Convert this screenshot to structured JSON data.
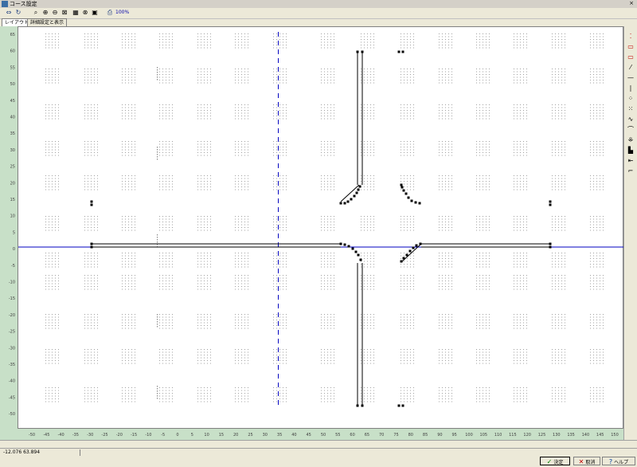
{
  "window": {
    "title": "コース設定",
    "close_glyph": "×"
  },
  "toolbar": {
    "zoom_label": "100%",
    "tools": [
      {
        "name": "open-icon",
        "glyph": "⇔"
      },
      {
        "name": "redo-icon",
        "glyph": "↻"
      },
      {
        "name": "zoom-icon",
        "glyph": "⌕"
      },
      {
        "name": "zoom-in-icon",
        "glyph": "⊕"
      },
      {
        "name": "zoom-out-icon",
        "glyph": "⊖"
      },
      {
        "name": "fit-icon",
        "glyph": "⊠"
      },
      {
        "name": "grid-icon",
        "glyph": "▦"
      },
      {
        "name": "link-icon",
        "glyph": "⊗"
      },
      {
        "name": "frame-icon",
        "glyph": "▣"
      },
      {
        "name": "print-icon",
        "glyph": "⎙"
      }
    ]
  },
  "tabs": [
    {
      "label": "レイアウト変更",
      "active": true
    },
    {
      "label": "詳細設定と表示",
      "active": false
    }
  ],
  "right_tools": [
    {
      "name": "select-point-icon",
      "glyph": "⁚",
      "red": true
    },
    {
      "name": "select-rect-icon",
      "glyph": "▭",
      "red": true
    },
    {
      "name": "select-line-icon",
      "glyph": "▭",
      "red": true
    },
    {
      "name": "line-diag-icon",
      "glyph": "⁄",
      "red": false
    },
    {
      "name": "line-horizontal-icon",
      "glyph": "—",
      "red": false
    },
    {
      "name": "line-vertical-icon",
      "glyph": "|",
      "red": false
    },
    {
      "name": "dots-diag-icon",
      "glyph": "⁘",
      "red": false
    },
    {
      "name": "dots-icon",
      "glyph": "⁙",
      "red": false
    },
    {
      "name": "curve-icon",
      "glyph": "∿",
      "red": false
    },
    {
      "name": "arc-icon",
      "glyph": "⌒",
      "red": false
    },
    {
      "name": "pattern-icon",
      "glyph": "⁜",
      "red": false
    },
    {
      "name": "fill-icon",
      "glyph": "▙",
      "red": false
    },
    {
      "name": "arrow-icon",
      "glyph": "⇤",
      "red": false
    },
    {
      "name": "corner-icon",
      "glyph": "⌐",
      "red": false
    }
  ],
  "status": {
    "coordinates": "-12.076  63.894"
  },
  "buttons": {
    "ok": {
      "label": "決定",
      "icon": "✓"
    },
    "cancel": {
      "label": "取消",
      "icon": "✕"
    },
    "help": {
      "label": "ヘルプ",
      "icon": "?"
    }
  },
  "axes": {
    "y_ticks": [
      "65",
      "60",
      "55",
      "50",
      "45",
      "40",
      "35",
      "30",
      "25",
      "20",
      "15",
      "10",
      "5",
      "0",
      "-5",
      "-10",
      "-15",
      "-20",
      "-25",
      "-30",
      "-35",
      "-40",
      "-45",
      "-50",
      "-55"
    ],
    "x_ticks": [
      "-50",
      "-45",
      "-40",
      "-35",
      "-30",
      "-25",
      "-20",
      "-15",
      "-10",
      "-5",
      "0",
      "5",
      "10",
      "15",
      "20",
      "25",
      "30",
      "35",
      "40",
      "45",
      "50",
      "55",
      "60",
      "65",
      "70",
      "75",
      "80",
      "85",
      "90",
      "95",
      "100",
      "105",
      "110",
      "115",
      "120",
      "125",
      "130",
      "135",
      "140",
      "145",
      "150"
    ]
  },
  "colors": {
    "axis_line": "#0000c0",
    "panel_green": "#c8e0c8",
    "grid_dot": "#a0a0a0",
    "course_line": "#000000"
  }
}
